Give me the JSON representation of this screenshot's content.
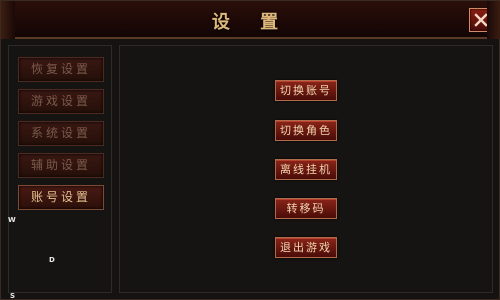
{
  "window": {
    "title": "设 置"
  },
  "sidebar": {
    "items": [
      {
        "label": "恢复设置"
      },
      {
        "label": "游戏设置"
      },
      {
        "label": "系统设置"
      },
      {
        "label": "辅助设置"
      },
      {
        "label": "账号设置",
        "active": true
      }
    ]
  },
  "account_panel": {
    "buttons": [
      {
        "label": "切换账号"
      },
      {
        "label": "切换角色"
      },
      {
        "label": "离线挂机"
      },
      {
        "label": "转移码"
      },
      {
        "label": "退出游戏"
      }
    ]
  },
  "overlay_markers": {
    "w": "W",
    "d": "D",
    "s": "S"
  },
  "colors": {
    "title": "#e0b77a",
    "button_red": "#8a2418",
    "active_text": "#e6c28f"
  }
}
